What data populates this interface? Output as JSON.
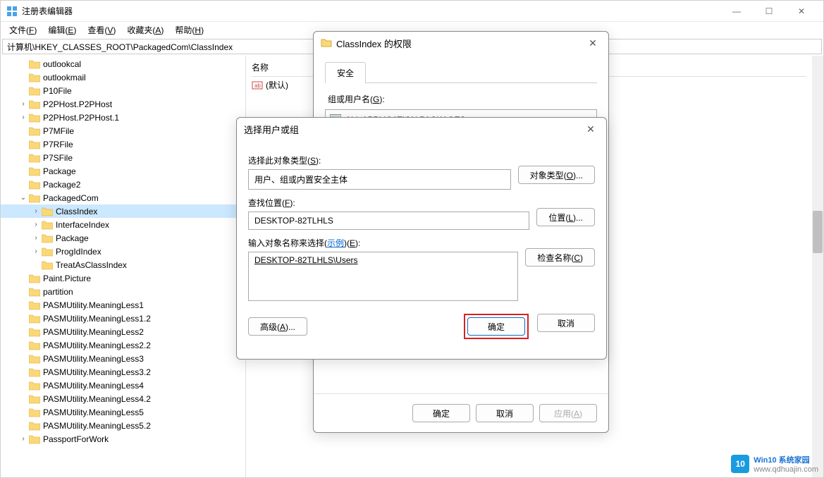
{
  "window": {
    "title": "注册表编辑器"
  },
  "menu": {
    "file": "文件(F)",
    "edit": "编辑(E)",
    "view": "查看(V)",
    "fav": "收藏夹(A)",
    "help": "帮助(H)"
  },
  "address": "计算机\\HKEY_CLASSES_ROOT\\PackagedCom\\ClassIndex",
  "list": {
    "header_name": "名称",
    "default_row": "(默认)"
  },
  "tree": [
    {
      "lvl": 1,
      "arrow": "",
      "label": "outlookcal"
    },
    {
      "lvl": 1,
      "arrow": "",
      "label": "outlookmail"
    },
    {
      "lvl": 1,
      "arrow": "",
      "label": "P10File"
    },
    {
      "lvl": 1,
      "arrow": ">",
      "label": "P2PHost.P2PHost"
    },
    {
      "lvl": 1,
      "arrow": ">",
      "label": "P2PHost.P2PHost.1"
    },
    {
      "lvl": 1,
      "arrow": "",
      "label": "P7MFile"
    },
    {
      "lvl": 1,
      "arrow": "",
      "label": "P7RFile"
    },
    {
      "lvl": 1,
      "arrow": "",
      "label": "P7SFile"
    },
    {
      "lvl": 1,
      "arrow": "",
      "label": "Package"
    },
    {
      "lvl": 1,
      "arrow": "",
      "label": "Package2"
    },
    {
      "lvl": 1,
      "arrow": "v",
      "label": "PackagedCom"
    },
    {
      "lvl": 2,
      "arrow": ">",
      "label": "ClassIndex",
      "sel": true
    },
    {
      "lvl": 2,
      "arrow": ">",
      "label": "InterfaceIndex"
    },
    {
      "lvl": 2,
      "arrow": ">",
      "label": "Package"
    },
    {
      "lvl": 2,
      "arrow": ">",
      "label": "ProgIdIndex"
    },
    {
      "lvl": 2,
      "arrow": "",
      "label": "TreatAsClassIndex"
    },
    {
      "lvl": 1,
      "arrow": "",
      "label": "Paint.Picture"
    },
    {
      "lvl": 1,
      "arrow": "",
      "label": "partition"
    },
    {
      "lvl": 1,
      "arrow": "",
      "label": "PASMUtility.MeaningLess1"
    },
    {
      "lvl": 1,
      "arrow": "",
      "label": "PASMUtility.MeaningLess1.2"
    },
    {
      "lvl": 1,
      "arrow": "",
      "label": "PASMUtility.MeaningLess2"
    },
    {
      "lvl": 1,
      "arrow": "",
      "label": "PASMUtility.MeaningLess2.2"
    },
    {
      "lvl": 1,
      "arrow": "",
      "label": "PASMUtility.MeaningLess3"
    },
    {
      "lvl": 1,
      "arrow": "",
      "label": "PASMUtility.MeaningLess3.2"
    },
    {
      "lvl": 1,
      "arrow": "",
      "label": "PASMUtility.MeaningLess4"
    },
    {
      "lvl": 1,
      "arrow": "",
      "label": "PASMUtility.MeaningLess4.2"
    },
    {
      "lvl": 1,
      "arrow": "",
      "label": "PASMUtility.MeaningLess5"
    },
    {
      "lvl": 1,
      "arrow": "",
      "label": "PASMUtility.MeaningLess5.2"
    },
    {
      "lvl": 1,
      "arrow": ">",
      "label": "PassportForWork"
    }
  ],
  "perm": {
    "title": "ClassIndex 的权限",
    "tab_security": "安全",
    "group_label": "组或用户名(G):",
    "group0": "ALL APPLICATION PACKAGES",
    "btn_ok": "确定",
    "btn_cancel": "取消",
    "btn_apply": "应用(A)"
  },
  "sel": {
    "title": "选择用户或组",
    "obj_type_lbl": "选择此对象类型(S):",
    "obj_type_val": "用户、组或内置安全主体",
    "btn_obj_type": "对象类型(O)...",
    "location_lbl": "查找位置(F):",
    "location_val": "DESKTOP-82TLHLS",
    "btn_location": "位置(L)...",
    "enter_lbl_prefix": "输入对象名称来选择(",
    "enter_lbl_link": "示例",
    "enter_lbl_suffix": ")(E):",
    "enter_val": "DESKTOP-82TLHLS\\Users",
    "btn_check": "检查名称(C)",
    "btn_advanced": "高级(A)...",
    "btn_ok": "确定",
    "btn_cancel": "取消"
  },
  "watermark": {
    "brand": "Win10 系统家园",
    "url": "www.qdhuajin.com",
    "icon": "10"
  }
}
